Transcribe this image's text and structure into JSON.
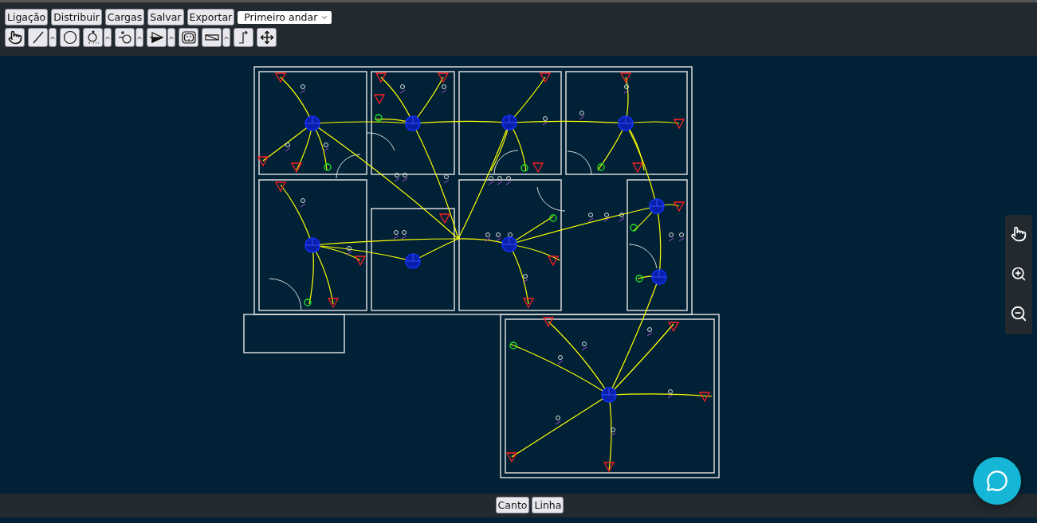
{
  "toolbar": {
    "buttons": [
      {
        "label": "Ligação"
      },
      {
        "label": "Distribuir"
      },
      {
        "label": "Cargas"
      },
      {
        "label": "Salvar"
      },
      {
        "label": "Exportar"
      }
    ],
    "floor_select": {
      "value": "Primeiro andar"
    },
    "tools": [
      {
        "kind": "pointer",
        "has_menu": false
      },
      {
        "kind": "line",
        "has_menu": true
      },
      {
        "kind": "circle",
        "has_menu": false
      },
      {
        "kind": "light",
        "has_menu": true
      },
      {
        "kind": "switch",
        "has_menu": true
      },
      {
        "kind": "panel",
        "has_menu": true
      },
      {
        "kind": "outlet",
        "has_menu": false
      },
      {
        "kind": "conduit",
        "has_menu": true
      },
      {
        "kind": "riser",
        "has_menu": false
      },
      {
        "kind": "move",
        "has_menu": false
      }
    ]
  },
  "side_tools": [
    {
      "kind": "pan"
    },
    {
      "kind": "zoom_in"
    },
    {
      "kind": "zoom_out"
    }
  ],
  "status_bar": {
    "buttons": [
      {
        "label": "Canto"
      },
      {
        "label": "Linha"
      }
    ]
  }
}
